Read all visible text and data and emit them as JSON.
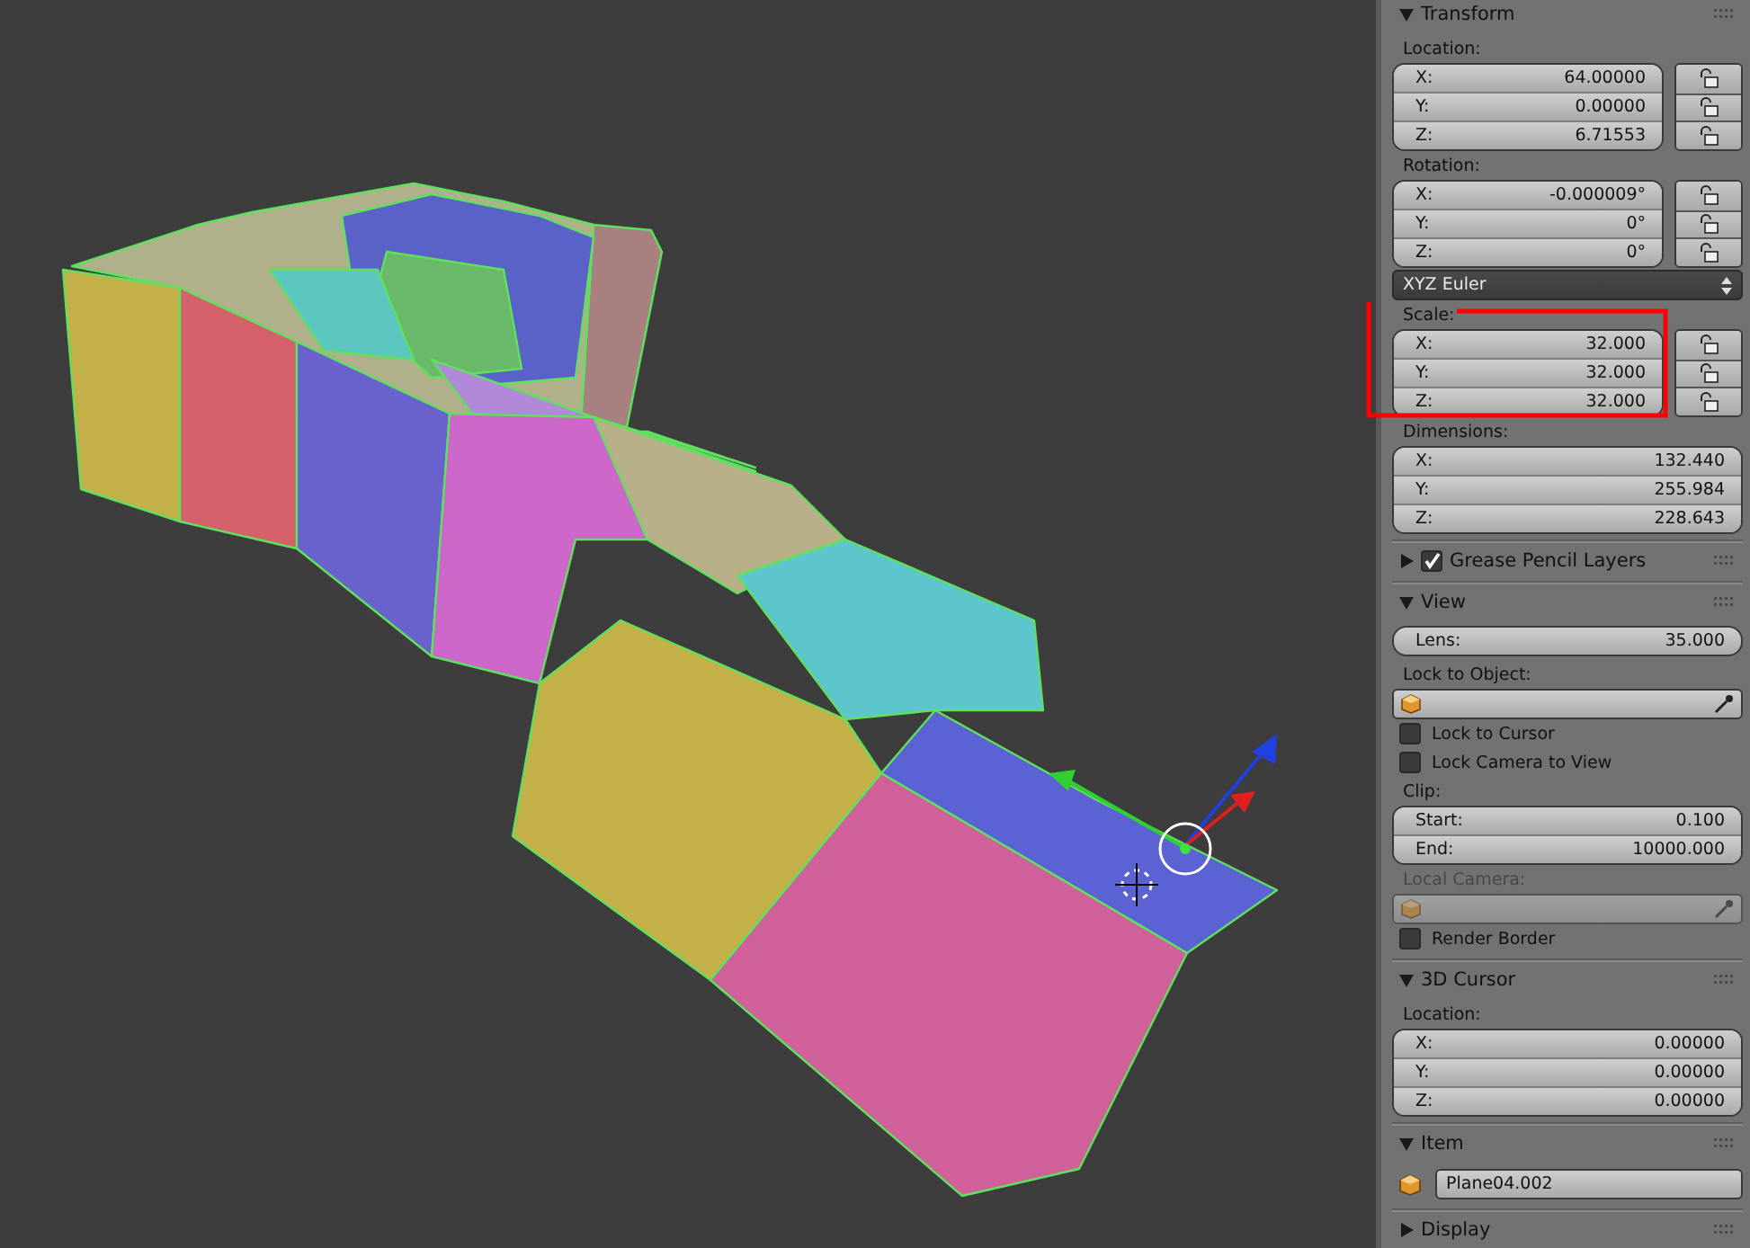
{
  "sections": [
    {
      "title": "Transform",
      "expanded": true,
      "items": [
        {
          "kind": "label",
          "text": "Location:",
          "disabled": false
        },
        {
          "kind": "vector",
          "locks": true,
          "fields": [
            {
              "label": "X:",
              "value": "64.00000",
              "locked": false
            },
            {
              "label": "Y:",
              "value": "0.00000",
              "locked": false
            },
            {
              "label": "Z:",
              "value": "6.71553",
              "locked": false
            }
          ]
        },
        {
          "kind": "label",
          "text": "Rotation:",
          "disabled": false
        },
        {
          "kind": "vector",
          "locks": true,
          "fields": [
            {
              "label": "X:",
              "value": "-0.000009°",
              "locked": false
            },
            {
              "label": "Y:",
              "value": "0°",
              "locked": false
            },
            {
              "label": "Z:",
              "value": "0°",
              "locked": false
            }
          ]
        },
        {
          "kind": "dropdown",
          "value": "XYZ Euler"
        },
        {
          "kind": "label",
          "text": "Scale:",
          "disabled": false
        },
        {
          "kind": "vector",
          "locks": true,
          "fields": [
            {
              "label": "X:",
              "value": "32.000",
              "locked": false
            },
            {
              "label": "Y:",
              "value": "32.000",
              "locked": false
            },
            {
              "label": "Z:",
              "value": "32.000",
              "locked": false
            }
          ]
        },
        {
          "kind": "label",
          "text": "Dimensions:",
          "disabled": false
        },
        {
          "kind": "vector",
          "locks": false,
          "fields": [
            {
              "label": "X:",
              "value": "132.440"
            },
            {
              "label": "Y:",
              "value": "255.984"
            },
            {
              "label": "Z:",
              "value": "228.643"
            }
          ]
        }
      ]
    },
    {
      "title": "Grease Pencil Layers",
      "expanded": false,
      "checkbox": {
        "checked": true
      }
    },
    {
      "title": "View",
      "expanded": true,
      "items": [
        {
          "kind": "field",
          "label": "Lens:",
          "value": "35.000"
        },
        {
          "kind": "label",
          "text": "Lock to Object:",
          "disabled": false
        },
        {
          "kind": "object",
          "disabled": false
        },
        {
          "kind": "checkbox",
          "text": "Lock to Cursor",
          "checked": false
        },
        {
          "kind": "checkbox",
          "text": "Lock Camera to View",
          "checked": false
        },
        {
          "kind": "label",
          "text": "Clip:",
          "disabled": false
        },
        {
          "kind": "vector",
          "locks": false,
          "fields": [
            {
              "label": "Start:",
              "value": "0.100"
            },
            {
              "label": "End:",
              "value": "10000.000"
            }
          ]
        },
        {
          "kind": "label",
          "text": "Local Camera:",
          "disabled": true
        },
        {
          "kind": "object",
          "disabled": true
        },
        {
          "kind": "checkbox",
          "text": "Render Border",
          "checked": false
        }
      ]
    },
    {
      "title": "3D Cursor",
      "expanded": true,
      "items": [
        {
          "kind": "label",
          "text": "Location:",
          "disabled": false
        },
        {
          "kind": "vector",
          "locks": false,
          "fields": [
            {
              "label": "X:",
              "value": "0.00000"
            },
            {
              "label": "Y:",
              "value": "0.00000"
            },
            {
              "label": "Z:",
              "value": "0.00000"
            }
          ]
        }
      ]
    },
    {
      "title": "Item",
      "expanded": true,
      "items": [
        {
          "kind": "name",
          "value": "Plane04.002"
        }
      ]
    },
    {
      "title": "Display",
      "expanded": false
    }
  ]
}
